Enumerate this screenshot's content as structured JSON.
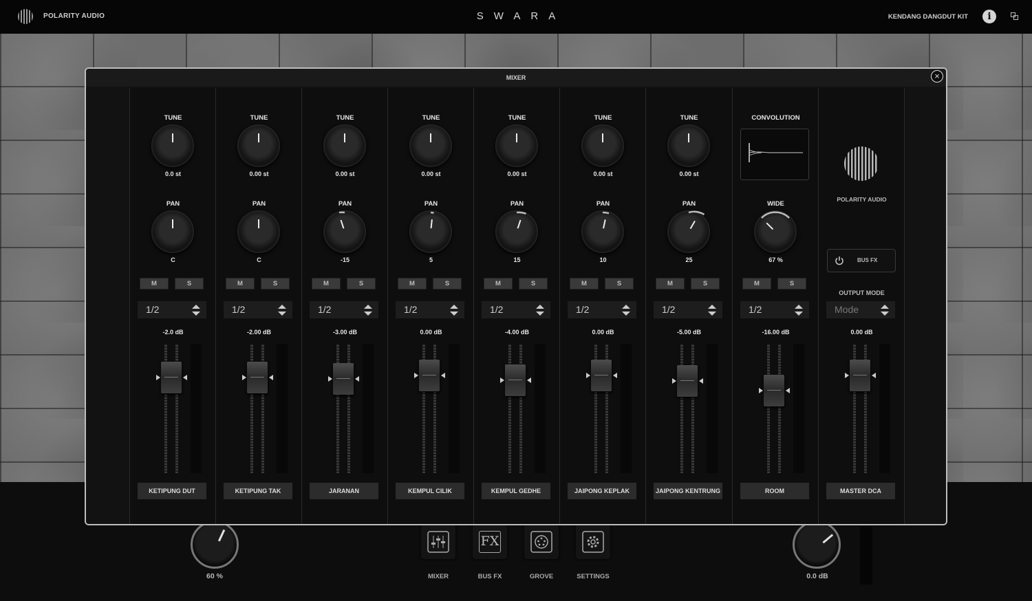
{
  "header": {
    "brand": "POLARITY AUDIO",
    "title": "SWARA",
    "kit": "KENDANG DANGDUT KIT",
    "info": "i"
  },
  "mixer": {
    "title": "MIXER",
    "channels": [
      {
        "top_label": "TUNE",
        "tune": "0.0 st",
        "pan_label": "PAN",
        "pan": "C",
        "pan_value": 0,
        "mute": "M",
        "solo": "S",
        "select": "1/2",
        "gain": "-2.0 dB",
        "fader": 0.82,
        "name": "KETIPUNG DUT"
      },
      {
        "top_label": "TUNE",
        "tune": "0.00 st",
        "pan_label": "PAN",
        "pan": "C",
        "pan_value": 0,
        "mute": "M",
        "solo": "S",
        "select": "1/2",
        "gain": "-2.00 dB",
        "fader": 0.82,
        "name": "KETIPUNG TAK"
      },
      {
        "top_label": "TUNE",
        "tune": "0.00 st",
        "pan_label": "PAN",
        "pan": "-15",
        "pan_value": -15,
        "mute": "M",
        "solo": "S",
        "select": "1/2",
        "gain": "-3.00 dB",
        "fader": 0.8,
        "name": "JARANAN"
      },
      {
        "top_label": "TUNE",
        "tune": "0.00 st",
        "pan_label": "PAN",
        "pan": "5",
        "pan_value": 5,
        "mute": "M",
        "solo": "S",
        "select": "1/2",
        "gain": "0.00 dB",
        "fader": 0.84,
        "name": "KEMPUL CILIK"
      },
      {
        "top_label": "TUNE",
        "tune": "0.00 st",
        "pan_label": "PAN",
        "pan": "15",
        "pan_value": 15,
        "mute": "M",
        "solo": "S",
        "select": "1/2",
        "gain": "-4.00 dB",
        "fader": 0.79,
        "name": "KEMPUL GEDHE"
      },
      {
        "top_label": "TUNE",
        "tune": "0.00 st",
        "pan_label": "PAN",
        "pan": "10",
        "pan_value": 10,
        "mute": "M",
        "solo": "S",
        "select": "1/2",
        "gain": "0.00 dB",
        "fader": 0.84,
        "name": "JAIPONG KEPLAK"
      },
      {
        "top_label": "TUNE",
        "tune": "0.00 st",
        "pan_label": "PAN",
        "pan": "25",
        "pan_value": 25,
        "mute": "M",
        "solo": "S",
        "select": "1/2",
        "gain": "-5.00 dB",
        "fader": 0.78,
        "name": "JAIPONG KENTRUNG"
      }
    ],
    "room": {
      "top_label": "CONVOLUTION",
      "width_label": "WIDE",
      "width": "67 %",
      "mute": "M",
      "solo": "S",
      "select": "1/2",
      "gain": "-16.00 dB",
      "fader": 0.68,
      "name": "ROOM"
    },
    "master": {
      "brand": "POLARITY AUDIO",
      "bus_fx": "BUS FX",
      "output_mode_label": "OUTPUT MODE",
      "mode_placeholder": "Mode",
      "gain": "0.00 dB",
      "fader": 0.84,
      "name": "MASTER DCA"
    }
  },
  "bottom": {
    "left_knob_value": "60 %",
    "right_knob_value": "0.0 dB",
    "nav": [
      {
        "label": "MIXER",
        "icon": "mixer-icon"
      },
      {
        "label": "BUS FX",
        "icon": "fx-icon",
        "glyph": "FX"
      },
      {
        "label": "GROVE",
        "icon": "groove-icon"
      },
      {
        "label": "SETTINGS",
        "icon": "gear-icon"
      }
    ]
  }
}
